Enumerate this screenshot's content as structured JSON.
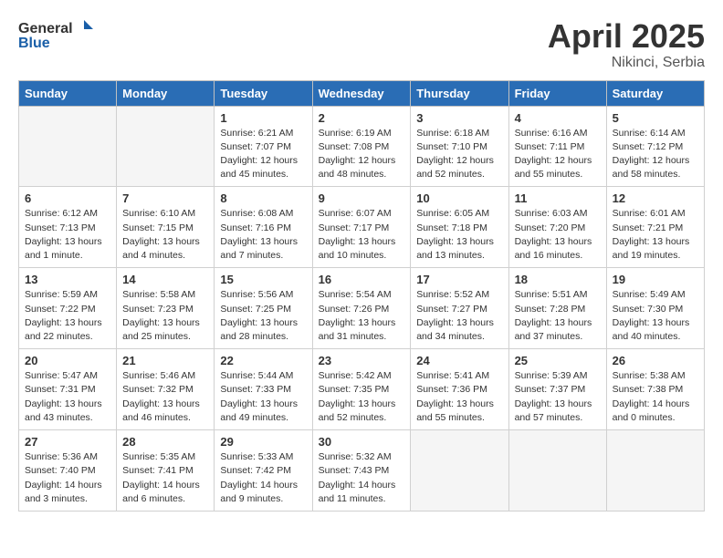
{
  "header": {
    "logo_general": "General",
    "logo_blue": "Blue",
    "title": "April 2025",
    "location": "Nikinci, Serbia"
  },
  "weekdays": [
    "Sunday",
    "Monday",
    "Tuesday",
    "Wednesday",
    "Thursday",
    "Friday",
    "Saturday"
  ],
  "weeks": [
    [
      {
        "day": "",
        "info": ""
      },
      {
        "day": "",
        "info": ""
      },
      {
        "day": "1",
        "info": "Sunrise: 6:21 AM\nSunset: 7:07 PM\nDaylight: 12 hours and 45 minutes."
      },
      {
        "day": "2",
        "info": "Sunrise: 6:19 AM\nSunset: 7:08 PM\nDaylight: 12 hours and 48 minutes."
      },
      {
        "day": "3",
        "info": "Sunrise: 6:18 AM\nSunset: 7:10 PM\nDaylight: 12 hours and 52 minutes."
      },
      {
        "day": "4",
        "info": "Sunrise: 6:16 AM\nSunset: 7:11 PM\nDaylight: 12 hours and 55 minutes."
      },
      {
        "day": "5",
        "info": "Sunrise: 6:14 AM\nSunset: 7:12 PM\nDaylight: 12 hours and 58 minutes."
      }
    ],
    [
      {
        "day": "6",
        "info": "Sunrise: 6:12 AM\nSunset: 7:13 PM\nDaylight: 13 hours and 1 minute."
      },
      {
        "day": "7",
        "info": "Sunrise: 6:10 AM\nSunset: 7:15 PM\nDaylight: 13 hours and 4 minutes."
      },
      {
        "day": "8",
        "info": "Sunrise: 6:08 AM\nSunset: 7:16 PM\nDaylight: 13 hours and 7 minutes."
      },
      {
        "day": "9",
        "info": "Sunrise: 6:07 AM\nSunset: 7:17 PM\nDaylight: 13 hours and 10 minutes."
      },
      {
        "day": "10",
        "info": "Sunrise: 6:05 AM\nSunset: 7:18 PM\nDaylight: 13 hours and 13 minutes."
      },
      {
        "day": "11",
        "info": "Sunrise: 6:03 AM\nSunset: 7:20 PM\nDaylight: 13 hours and 16 minutes."
      },
      {
        "day": "12",
        "info": "Sunrise: 6:01 AM\nSunset: 7:21 PM\nDaylight: 13 hours and 19 minutes."
      }
    ],
    [
      {
        "day": "13",
        "info": "Sunrise: 5:59 AM\nSunset: 7:22 PM\nDaylight: 13 hours and 22 minutes."
      },
      {
        "day": "14",
        "info": "Sunrise: 5:58 AM\nSunset: 7:23 PM\nDaylight: 13 hours and 25 minutes."
      },
      {
        "day": "15",
        "info": "Sunrise: 5:56 AM\nSunset: 7:25 PM\nDaylight: 13 hours and 28 minutes."
      },
      {
        "day": "16",
        "info": "Sunrise: 5:54 AM\nSunset: 7:26 PM\nDaylight: 13 hours and 31 minutes."
      },
      {
        "day": "17",
        "info": "Sunrise: 5:52 AM\nSunset: 7:27 PM\nDaylight: 13 hours and 34 minutes."
      },
      {
        "day": "18",
        "info": "Sunrise: 5:51 AM\nSunset: 7:28 PM\nDaylight: 13 hours and 37 minutes."
      },
      {
        "day": "19",
        "info": "Sunrise: 5:49 AM\nSunset: 7:30 PM\nDaylight: 13 hours and 40 minutes."
      }
    ],
    [
      {
        "day": "20",
        "info": "Sunrise: 5:47 AM\nSunset: 7:31 PM\nDaylight: 13 hours and 43 minutes."
      },
      {
        "day": "21",
        "info": "Sunrise: 5:46 AM\nSunset: 7:32 PM\nDaylight: 13 hours and 46 minutes."
      },
      {
        "day": "22",
        "info": "Sunrise: 5:44 AM\nSunset: 7:33 PM\nDaylight: 13 hours and 49 minutes."
      },
      {
        "day": "23",
        "info": "Sunrise: 5:42 AM\nSunset: 7:35 PM\nDaylight: 13 hours and 52 minutes."
      },
      {
        "day": "24",
        "info": "Sunrise: 5:41 AM\nSunset: 7:36 PM\nDaylight: 13 hours and 55 minutes."
      },
      {
        "day": "25",
        "info": "Sunrise: 5:39 AM\nSunset: 7:37 PM\nDaylight: 13 hours and 57 minutes."
      },
      {
        "day": "26",
        "info": "Sunrise: 5:38 AM\nSunset: 7:38 PM\nDaylight: 14 hours and 0 minutes."
      }
    ],
    [
      {
        "day": "27",
        "info": "Sunrise: 5:36 AM\nSunset: 7:40 PM\nDaylight: 14 hours and 3 minutes."
      },
      {
        "day": "28",
        "info": "Sunrise: 5:35 AM\nSunset: 7:41 PM\nDaylight: 14 hours and 6 minutes."
      },
      {
        "day": "29",
        "info": "Sunrise: 5:33 AM\nSunset: 7:42 PM\nDaylight: 14 hours and 9 minutes."
      },
      {
        "day": "30",
        "info": "Sunrise: 5:32 AM\nSunset: 7:43 PM\nDaylight: 14 hours and 11 minutes."
      },
      {
        "day": "",
        "info": ""
      },
      {
        "day": "",
        "info": ""
      },
      {
        "day": "",
        "info": ""
      }
    ]
  ]
}
